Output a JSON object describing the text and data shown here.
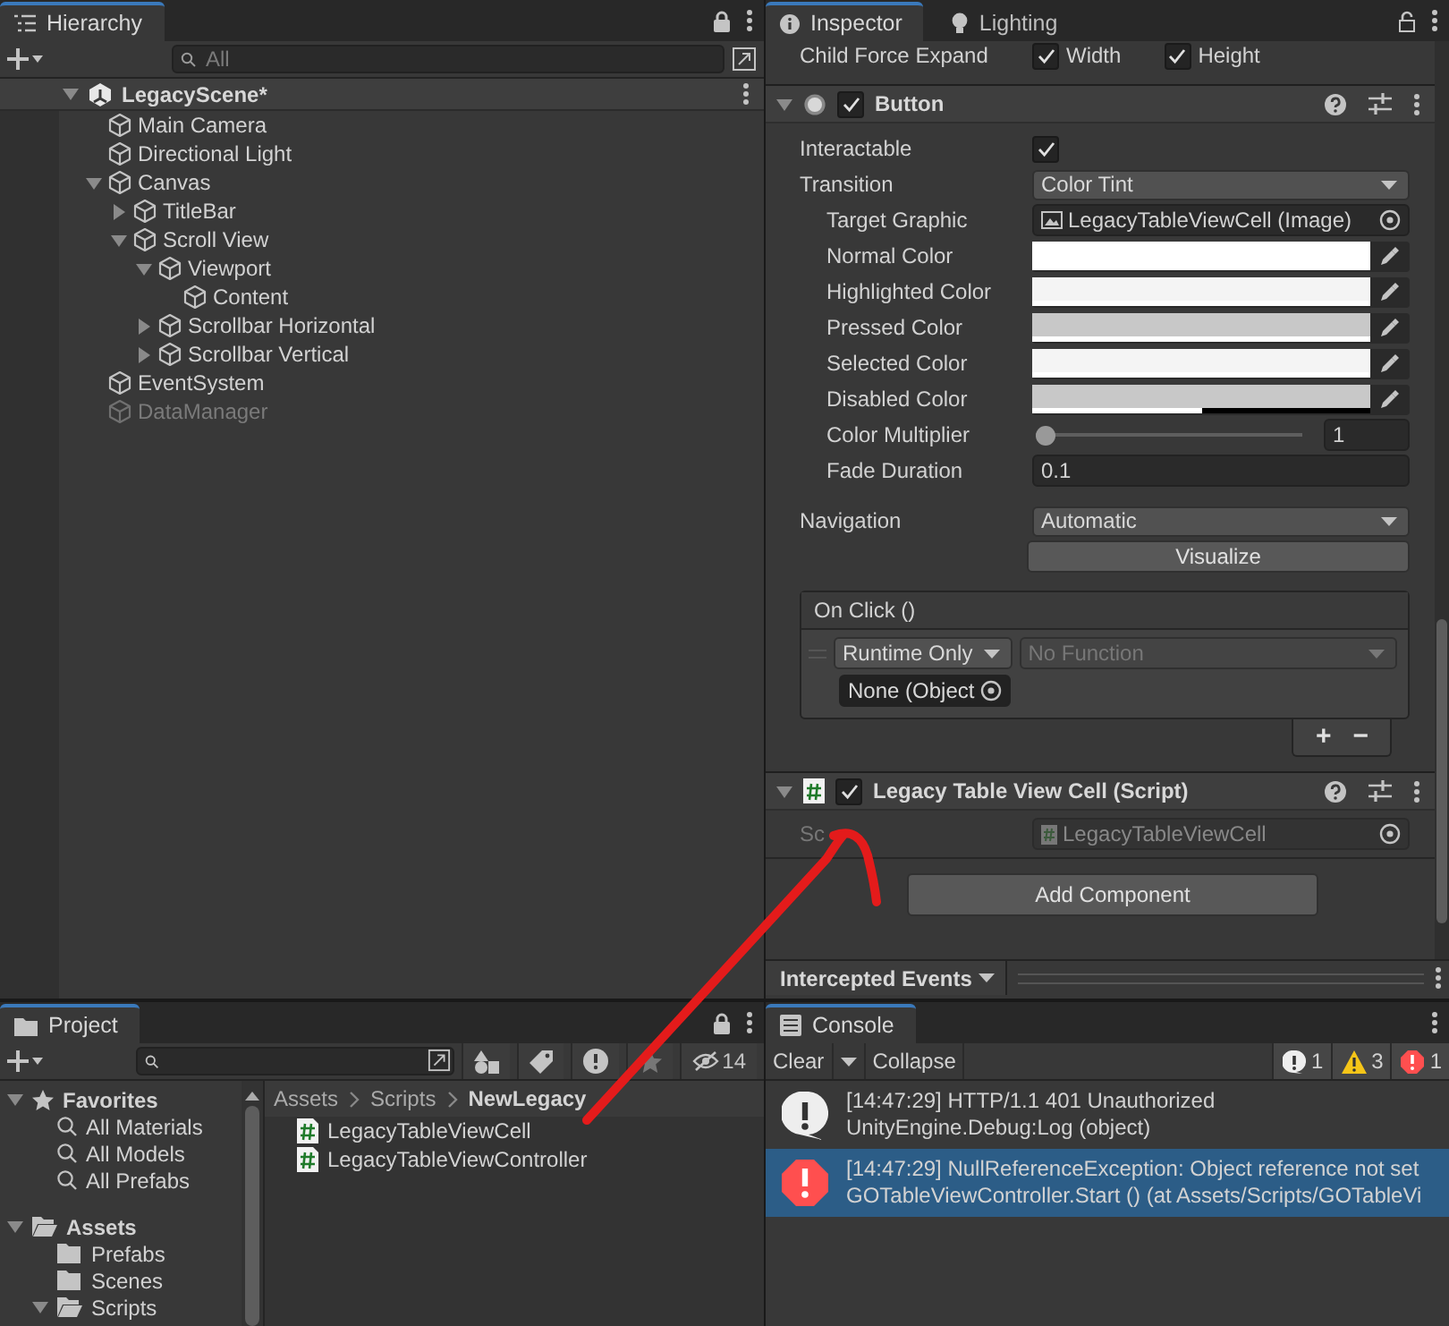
{
  "hierarchy": {
    "tab": "Hierarchy",
    "search": {
      "placeholder": "All"
    },
    "scene": {
      "name": "LegacyScene*",
      "expanded": true
    },
    "items": [
      {
        "name": "Main Camera",
        "active": true
      },
      {
        "name": "Directional Light",
        "active": true
      },
      {
        "name": "Canvas",
        "active": true,
        "expanded": true,
        "children": [
          {
            "name": "TitleBar",
            "active": true,
            "expanded": false
          },
          {
            "name": "Scroll View",
            "active": true,
            "expanded": true,
            "children": [
              {
                "name": "Viewport",
                "active": true,
                "expanded": true,
                "children": [
                  {
                    "name": "Content",
                    "active": true
                  }
                ]
              },
              {
                "name": "Scrollbar Horizontal",
                "active": true,
                "expanded": false
              },
              {
                "name": "Scrollbar Vertical",
                "active": true,
                "expanded": false
              }
            ]
          }
        ]
      },
      {
        "name": "EventSystem",
        "active": true
      },
      {
        "name": "DataManager",
        "active": false
      }
    ]
  },
  "inspector": {
    "tabs": [
      {
        "label": "Inspector",
        "selected": true
      },
      {
        "label": "Lighting",
        "selected": false
      }
    ],
    "child_force_expand": {
      "label": "Child Force Expand",
      "options": [
        {
          "label": "Width",
          "checked": true
        },
        {
          "label": "Height",
          "checked": true
        }
      ]
    },
    "button_component": {
      "title": "Button",
      "enabled": true,
      "expanded": true,
      "fields": [
        {
          "kind": "checkbox",
          "label": "Interactable",
          "checked": true
        },
        {
          "kind": "dropdown",
          "label": "Transition",
          "value": "Color Tint",
          "children": [
            {
              "kind": "object",
              "label": "Target Graphic",
              "value": "LegacyTableViewCell (Image)"
            },
            {
              "kind": "color",
              "label": "Normal Color",
              "color": "#ffffff",
              "level": 1
            },
            {
              "kind": "color",
              "label": "Highlighted Color",
              "color": "#f4f4f4",
              "level": 1
            },
            {
              "kind": "color",
              "label": "Pressed Color",
              "color": "#c8c8c8",
              "level": 1
            },
            {
              "kind": "color",
              "label": "Selected Color",
              "color": "#f4f4f4",
              "level": 1
            },
            {
              "kind": "color",
              "label": "Disabled Color",
              "color": "#c8c8c8",
              "level": 0.5
            },
            {
              "kind": "slider",
              "label": "Color Multiplier",
              "level": 0,
              "value": "1"
            },
            {
              "kind": "text",
              "label": "Fade Duration",
              "value": "0.1"
            }
          ]
        }
      ],
      "navigation": {
        "label": "Navigation",
        "value": "Automatic"
      },
      "visualize_button": "Visualize",
      "on_click": {
        "title": "On Click ()",
        "mode": "Runtime Only",
        "function_placeholder": "No Function",
        "object": "None (Object",
        "add": "+",
        "remove": "−"
      }
    },
    "script_component": {
      "title": "Legacy Table View Cell (Script)",
      "enabled": true,
      "expanded": true,
      "field": {
        "label": "Sc",
        "value": "LegacyTableViewCell"
      }
    },
    "add_component": "Add Component",
    "intercepted_events": "Intercepted Events"
  },
  "project": {
    "tab": "Project",
    "hidden_count": "14",
    "favorites": {
      "label": "Favorites",
      "expanded": true,
      "items": [
        "All Materials",
        "All Models",
        "All Prefabs"
      ]
    },
    "assets": {
      "label": "Assets",
      "expanded": true,
      "children": [
        {
          "name": "Prefabs"
        },
        {
          "name": "Scenes"
        },
        {
          "name": "Scripts",
          "expanded": true
        }
      ]
    },
    "breadcrumb": [
      "Assets",
      "Scripts",
      "NewLegacy"
    ],
    "files": [
      "LegacyTableViewCell",
      "LegacyTableViewController"
    ]
  },
  "console": {
    "tab": "Console",
    "clear": "Clear",
    "collapse": "Collapse",
    "counts": [
      {
        "kind": "info",
        "count": "1"
      },
      {
        "kind": "warning",
        "count": "3"
      },
      {
        "kind": "error",
        "count": "1"
      }
    ],
    "entries": [
      {
        "kind": "info",
        "selected": false,
        "line1": "[14:47:29] HTTP/1.1 401 Unauthorized",
        "line2": "UnityEngine.Debug:Log (object)"
      },
      {
        "kind": "error",
        "selected": true,
        "line1": "[14:47:29] NullReferenceException: Object reference not set",
        "line2": "GOTableViewController.Start () (at Assets/Scripts/GOTableVi"
      }
    ]
  }
}
